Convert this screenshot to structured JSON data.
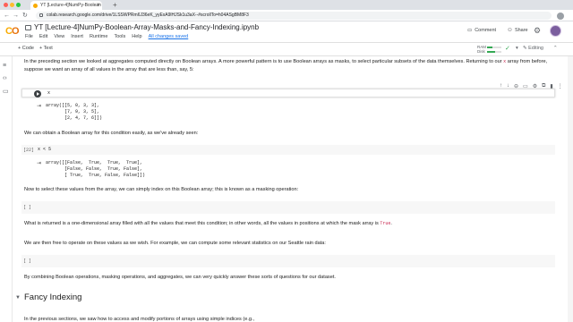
{
  "browser": {
    "tab_title": "YT [Lecture-4]NumPy-Boolean",
    "url": "colab.research.google.com/drive/1LSSWPRm6J36eK_yyExA9lHJSk1u3aX--#scrollTo=h04ASgBM8F3",
    "new_tab": "+",
    "tab_close": "×"
  },
  "colab": {
    "notebook_title": "YT [Lecture-4]NumPy-Boolean-Array-Masks-and-Fancy-Indexing.ipynb",
    "menu": [
      "File",
      "Edit",
      "View",
      "Insert",
      "Runtime",
      "Tools",
      "Help"
    ],
    "save_status": "All changes saved",
    "comment_label": "Comment",
    "share_label": "Share"
  },
  "toolbar": {
    "add_code": "+ Code",
    "add_text": "+ Text",
    "ram_label": "RAM",
    "disk_label": "Disk",
    "ram_fraction": 0.35,
    "disk_fraction": 0.55,
    "editing_label": "Editing"
  },
  "notebook": {
    "para1": "In the preceding section we looked at aggregates computed directly on Boolean arrays. A more powerful pattern is to use Boolean arrays as masks, to select particular subsets of the data themselves. Returning to our",
    "para1_code": "x",
    "para1_tail": "array from before, suppose we want an array of all values in the array that are less than, say, 5:",
    "cell1_input": "x",
    "cell1_output": "array([[5, 0, 3, 3],\n       [7, 9, 3, 5],\n       [2, 4, 7, 6]])",
    "para2": "We can obtain a Boolean array for this condition easily, as we've already seen:",
    "cell2_exec": "[22]",
    "cell2_input": "x < 5",
    "cell2_output": "array([[False,  True,  True,  True],\n       [False, False,  True, False],\n       [ True,  True, False, False]])",
    "para3": "Now to select these values from the array, we can simply index on this Boolean array; this is known as a masking operation:",
    "cell3_exec": "[ ]",
    "para4": "What is returned is a one-dimensional array filled with all the values that meet this condition; in other words, all the values in positions at which the mask array is",
    "para4_code": "True",
    "para4_end": ".",
    "para5": "We are then free to operate on these values as we wish. For example, we can compute some relevant statistics on our Seattle rain data:",
    "cell4_exec": "[ ]",
    "para6": "By combining Boolean operations, masking operations, and aggregates, we can very quickly answer these sorts of questions for our dataset.",
    "heading": "Fancy Indexing",
    "para7": "In the previous sections, we saw how to access and modify portions of arrays using simple indices (e.g.,"
  }
}
